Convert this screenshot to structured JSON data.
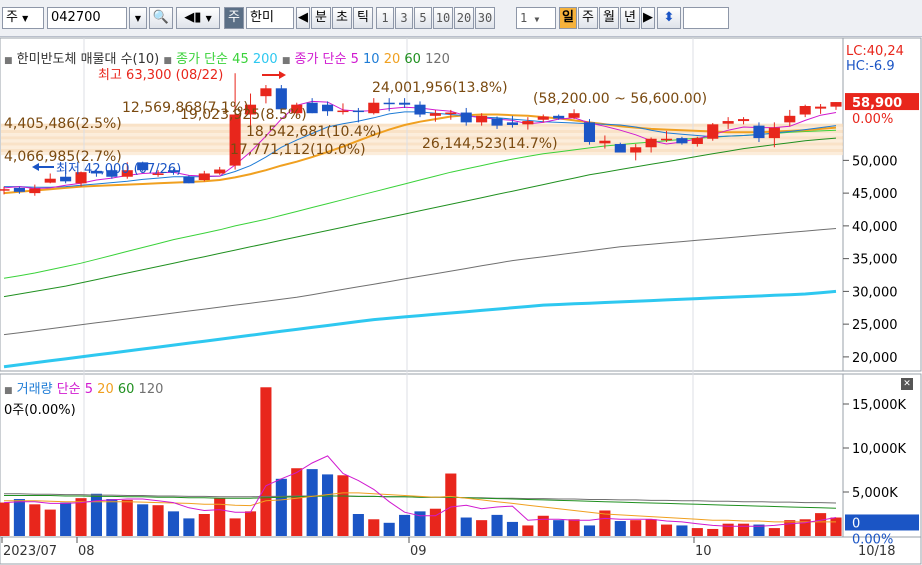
{
  "toolbar": {
    "period_type": "주",
    "code": "042700",
    "name": "한미",
    "mode_label": "주",
    "minute": "분",
    "second": "초",
    "tick": "틱",
    "intervals": [
      "1",
      "3",
      "5",
      "10",
      "20",
      "30"
    ],
    "count": "1",
    "day": "일",
    "week": "주",
    "month": "월",
    "year": "년"
  },
  "price_panel": {
    "legend_title": "한미반도체 매물대 수(10)",
    "ma_label": "종가 단순",
    "ma_long": [
      "45",
      "200"
    ],
    "ma_label2": "종가 단순",
    "ma_short": [
      "5",
      "10",
      "20",
      "60",
      "120"
    ],
    "high_label": "최고 63,300 (08/22)",
    "low_label": "최저 42,000 (07/26)",
    "range_label": "(58,200.00 ~ 56,600.00)",
    "lc_label": "LC:40,24",
    "hc_label": "HC:-6.9",
    "current_price": "58,900",
    "current_pct": "0.00%",
    "volume_profile_labels": [
      "12,569,868(7.1%)",
      "4,405,486(2.5%)",
      "19,023,925(8.5%)",
      "18,542,681(10.4%)",
      "17,771,112(10.0%)",
      "26,144,523(14.7%)",
      "4,066,985(2.7%)",
      "24,001,956(13.8%)"
    ],
    "price_ticks": [
      "50,000",
      "45,000",
      "40,000",
      "35,000",
      "30,000",
      "25,000",
      "20,000"
    ]
  },
  "volume_panel": {
    "legend_title": "거래량",
    "ma_label": "단순",
    "ma_periods": [
      "5",
      "20",
      "60",
      "120"
    ],
    "value_label": "0주(0.00%)",
    "ticks": [
      "15,000K",
      "10,000K",
      "5,000K"
    ],
    "current": "0",
    "current_pct": "0.00%"
  },
  "colors": {
    "up": "#e8261c",
    "down": "#1b55c5",
    "ma5": "#d01ad0",
    "ma10": "#1e7cd6",
    "ma20": "#f0a020",
    "ma60": "#209020",
    "ma120": "#707070",
    "ma45": "#3ad23a",
    "ma200": "#2ec8f0"
  },
  "chart_data": {
    "type": "candlestick",
    "x_labels": [
      "2023/07",
      "08",
      "09",
      "10",
      "10/18"
    ],
    "price_range": [
      18000,
      67000
    ],
    "volume_range": [
      0,
      17500
    ],
    "candles": [
      [
        45500,
        46000,
        44800,
        45600
      ],
      [
        45800,
        46000,
        44900,
        45200
      ],
      [
        45000,
        46300,
        44600,
        45700
      ],
      [
        46600,
        48000,
        46500,
        47200
      ],
      [
        47500,
        49300,
        46500,
        46800
      ],
      [
        46500,
        48300,
        46000,
        48200
      ],
      [
        48400,
        48500,
        47500,
        48000
      ],
      [
        48500,
        48700,
        47200,
        47500
      ],
      [
        47500,
        49700,
        47200,
        48500
      ],
      [
        49700,
        49800,
        48300,
        48500
      ],
      [
        48000,
        48500,
        47500,
        48000
      ],
      [
        48500,
        48700,
        47800,
        48200
      ],
      [
        47500,
        47700,
        46500,
        46500
      ],
      [
        47000,
        48400,
        46800,
        48000
      ],
      [
        48000,
        49000,
        47800,
        48600
      ],
      [
        49200,
        63300,
        48600,
        57000
      ],
      [
        57000,
        60200,
        55000,
        58500
      ],
      [
        59800,
        61500,
        58700,
        61000
      ],
      [
        61000,
        61500,
        57400,
        57800
      ],
      [
        57200,
        58800,
        56700,
        58500
      ],
      [
        58800,
        59500,
        57200,
        57200
      ],
      [
        58500,
        59000,
        56800,
        57500
      ],
      [
        57400,
        58700,
        57000,
        57600
      ],
      [
        57600,
        58000,
        55800,
        57500
      ],
      [
        57200,
        59500,
        57000,
        58800
      ],
      [
        58800,
        59500,
        57500,
        58700
      ],
      [
        58800,
        59500,
        58000,
        58500
      ],
      [
        58500,
        59000,
        56600,
        57000
      ],
      [
        56800,
        57700,
        55900,
        57200
      ],
      [
        57200,
        57700,
        56200,
        57300
      ],
      [
        57300,
        58000,
        55300,
        55800
      ],
      [
        55800,
        57200,
        55300,
        56800
      ],
      [
        56400,
        56700,
        54800,
        55300
      ],
      [
        55800,
        56800,
        55000,
        55400
      ],
      [
        55500,
        56600,
        54700,
        56000
      ],
      [
        56200,
        57000,
        55800,
        56700
      ],
      [
        56800,
        57000,
        56200,
        56400
      ],
      [
        56500,
        57800,
        56300,
        57200
      ],
      [
        55800,
        56300,
        52400,
        52800
      ],
      [
        52600,
        53800,
        51800,
        53000
      ],
      [
        52500,
        52700,
        51200,
        51200
      ],
      [
        51200,
        52500,
        50000,
        52000
      ],
      [
        52000,
        53500,
        51200,
        53300
      ],
      [
        53200,
        54500,
        52800,
        53300
      ],
      [
        53400,
        53600,
        52400,
        52600
      ],
      [
        52500,
        53600,
        52100,
        53400
      ],
      [
        53300,
        55700,
        53000,
        55500
      ],
      [
        55600,
        56600,
        54800,
        56000
      ],
      [
        56000,
        56600,
        55500,
        56300
      ],
      [
        55300,
        55800,
        52800,
        53400
      ],
      [
        53400,
        55800,
        52000,
        55000
      ],
      [
        55800,
        57700,
        55200,
        56800
      ],
      [
        57000,
        58500,
        56600,
        58300
      ],
      [
        57900,
        58600,
        57100,
        58200
      ],
      [
        58200,
        58900,
        57700,
        58900
      ]
    ],
    "volumes": [
      3800,
      4200,
      3600,
      3000,
      3800,
      4300,
      4800,
      4200,
      4100,
      3600,
      3500,
      2800,
      2000,
      2500,
      4300,
      2000,
      2800,
      16900,
      6500,
      7700,
      7600,
      7000,
      6900,
      2500,
      1900,
      1500,
      2400,
      2800,
      3100,
      7100,
      2100,
      1800,
      2400,
      1600,
      1200,
      2300,
      1800,
      1900,
      1200,
      2900,
      1700,
      1800,
      1900,
      1300,
      1200,
      900,
      800,
      1400,
      1400,
      1300,
      900,
      1800,
      1900,
      2600,
      2100
    ],
    "ma5": [
      45800,
      46000,
      45700,
      45800,
      46200,
      46500,
      47000,
      47300,
      47700,
      48000,
      48100,
      48200,
      47700,
      47600,
      47600,
      49300,
      51300,
      53700,
      56300,
      58400,
      59000,
      58900,
      57700,
      57500,
      57600,
      57900,
      58100,
      58000,
      57700,
      57500,
      56800,
      56500,
      56300,
      56100,
      55600,
      55800,
      56300,
      56500,
      55700,
      55200,
      54600,
      53900,
      53000,
      52500,
      52800,
      53300,
      53900,
      54600,
      55100,
      55000,
      55000,
      55200,
      56100,
      56900,
      57300
    ],
    "ma10": [
      46000,
      46000,
      45900,
      45900,
      46000,
      46200,
      46400,
      46600,
      46800,
      47100,
      47300,
      47500,
      47500,
      47500,
      47600,
      48300,
      49200,
      50500,
      52000,
      53100,
      54100,
      55100,
      55600,
      56000,
      56500,
      57100,
      57400,
      57400,
      57200,
      57000,
      56800,
      56600,
      56500,
      56300,
      56100,
      55900,
      55800,
      55700,
      55600,
      55500,
      55400,
      55100,
      54600,
      54200,
      54000,
      53800,
      53600,
      53700,
      53800,
      53900,
      54200,
      54400,
      54700,
      55000,
      55300
    ],
    "ma20": [
      45000,
      45200,
      45400,
      45600,
      45800,
      46000,
      46100,
      46200,
      46300,
      46400,
      46500,
      46600,
      46700,
      46800,
      47000,
      47400,
      47900,
      48500,
      49200,
      49800,
      50500,
      51300,
      52100,
      53000,
      53900,
      54700,
      55400,
      55900,
      56300,
      56700,
      56900,
      57000,
      57000,
      56900,
      56800,
      56600,
      56400,
      56100,
      55800,
      55500,
      55200,
      55000,
      54800,
      54700,
      54600,
      54500,
      54400,
      54300,
      54300,
      54300,
      54400,
      54500,
      54600,
      54800,
      55000
    ],
    "ma45": [
      32000,
      32400,
      32800,
      33300,
      33800,
      34300,
      34900,
      35500,
      36100,
      36700,
      37300,
      37900,
      38400,
      38900,
      39400,
      40000,
      40500,
      41000,
      41600,
      42200,
      42800,
      43400,
      44000,
      44600,
      45200,
      45800,
      46400,
      47000,
      47600,
      48200,
      48700,
      49200,
      49700,
      50200,
      50600,
      51000,
      51300,
      51600,
      51900,
      52200,
      52400,
      52600,
      52800,
      53000,
      53200,
      53400,
      53500,
      53700,
      53800,
      54000,
      54100,
      54300,
      54400,
      54500,
      54600
    ],
    "ma60": [
      29200,
      29600,
      30000,
      30400,
      30800,
      31300,
      31800,
      32300,
      32800,
      33300,
      33800,
      34300,
      34800,
      35300,
      35800,
      36300,
      36800,
      37300,
      37800,
      38300,
      38800,
      39300,
      39800,
      40300,
      40800,
      41300,
      41800,
      42300,
      42800,
      43300,
      43800,
      44300,
      44800,
      45300,
      45800,
      46300,
      46800,
      47300,
      47800,
      48200,
      48600,
      49000,
      49400,
      49800,
      50200,
      50600,
      51000,
      51400,
      51800,
      52100,
      52400,
      52700,
      53000,
      53200,
      53400
    ],
    "ma120": [
      23400,
      23700,
      24000,
      24300,
      24600,
      24900,
      25200,
      25500,
      25800,
      26100,
      26400,
      26700,
      27000,
      27300,
      27600,
      27900,
      28200,
      28500,
      28800,
      29100,
      29500,
      29900,
      30300,
      30700,
      31100,
      31500,
      31900,
      32300,
      32700,
      33100,
      33500,
      33900,
      34300,
      34700,
      35000,
      35300,
      35600,
      35900,
      36200,
      36500,
      36800,
      37000,
      37200,
      37400,
      37600,
      37800,
      38000,
      38200,
      38400,
      38600,
      38800,
      39000,
      39200,
      39400,
      39600
    ],
    "ma200": [
      18500,
      18800,
      19100,
      19400,
      19700,
      20000,
      20300,
      20600,
      20900,
      21200,
      21500,
      21800,
      22100,
      22400,
      22700,
      23000,
      23300,
      23600,
      23900,
      24200,
      24500,
      24800,
      25100,
      25400,
      25700,
      25900,
      26100,
      26300,
      26500,
      26700,
      26900,
      27100,
      27300,
      27500,
      27700,
      27900,
      28000,
      28100,
      28200,
      28300,
      28400,
      28500,
      28600,
      28700,
      28800,
      28900,
      29000,
      29100,
      29200,
      29300,
      29400,
      29500,
      29600,
      29800,
      30000
    ],
    "vol_ma5": [
      3800,
      3900,
      3900,
      3700,
      3700,
      3800,
      4000,
      4100,
      4200,
      4200,
      4000,
      3800,
      3200,
      2900,
      3000,
      2700,
      2700,
      5700,
      6500,
      7200,
      8300,
      9100,
      7100,
      6300,
      5300,
      3900,
      2700,
      2300,
      2300,
      3300,
      3500,
      3100,
      3300,
      3400,
      1800,
      1900,
      1900,
      1800,
      1800,
      2000,
      1900,
      1900,
      1900,
      1700,
      1600,
      1400,
      1200,
      1100,
      1100,
      1100,
      1200,
      1400,
      1500,
      1800,
      2100
    ],
    "vol_ma20": [
      4000,
      4000,
      4000,
      3950,
      3900,
      3900,
      3900,
      3900,
      3900,
      3850,
      3800,
      3750,
      3700,
      3600,
      3600,
      3500,
      3450,
      4000,
      4100,
      4300,
      4500,
      4700,
      4900,
      4900,
      4800,
      4700,
      4600,
      4500,
      4400,
      4500,
      4300,
      4100,
      3900,
      3700,
      3500,
      3300,
      3100,
      2900,
      2700,
      2500,
      2400,
      2300,
      2200,
      2100,
      2000,
      1900,
      1800,
      1800,
      1700,
      1700,
      1600,
      1600,
      1600,
      1600,
      1600
    ],
    "vol_ma60": [
      4600,
      4600,
      4600,
      4600,
      4550,
      4550,
      4500,
      4500,
      4450,
      4450,
      4400,
      4400,
      4350,
      4350,
      4300,
      4300,
      4300,
      4350,
      4400,
      4450,
      4500,
      4550,
      4550,
      4500,
      4500,
      4450,
      4450,
      4400,
      4400,
      4400,
      4350,
      4300,
      4250,
      4200,
      4150,
      4100,
      4050,
      4000,
      3950,
      3900,
      3850,
      3800,
      3750,
      3700,
      3650,
      3600,
      3550,
      3500,
      3450,
      3400,
      3350,
      3300,
      3250,
      3200,
      3150
    ],
    "vol_ma120": [
      4800,
      4800,
      4750,
      4750,
      4700,
      4700,
      4650,
      4650,
      4600,
      4600,
      4550,
      4550,
      4500,
      4500,
      4450,
      4450,
      4450,
      4500,
      4500,
      4550,
      4550,
      4550,
      4550,
      4500,
      4500,
      4450,
      4450,
      4400,
      4400,
      4400,
      4350,
      4350,
      4300,
      4300,
      4250,
      4250,
      4200,
      4200,
      4150,
      4150,
      4100,
      4100,
      4050,
      4050,
      4000,
      4000,
      3950,
      3950,
      3900,
      3900,
      3850,
      3850,
      3800,
      3800,
      3750
    ]
  }
}
